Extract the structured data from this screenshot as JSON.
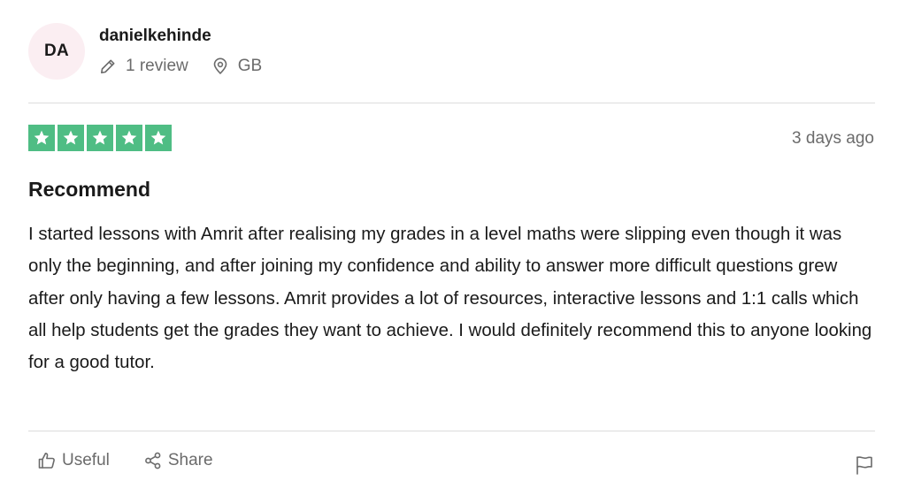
{
  "reviewer": {
    "initials": "DA",
    "name": "danielkehinde",
    "review_count": "1 review",
    "country": "GB",
    "avatar_bg": "#fbeef2"
  },
  "review": {
    "rating": 5,
    "rating_max": 5,
    "star_color": "#4fbd84",
    "date": "3 days ago",
    "title": "Recommend",
    "body": "I started lessons with Amrit after realising my grades in a level maths were slipping even though it was only the beginning, and after joining my confidence and ability to answer more difficult questions grew after only having a few lessons. Amrit provides a lot of resources, interactive lessons and 1:1 calls which all help students get the grades they want to achieve. I would definitely recommend this to anyone looking for a good tutor."
  },
  "actions": {
    "useful_label": "Useful",
    "share_label": "Share"
  },
  "icons": [
    "pencil-icon",
    "location-pin-icon",
    "star-icon",
    "thumbs-up-icon",
    "share-icon",
    "flag-icon"
  ]
}
